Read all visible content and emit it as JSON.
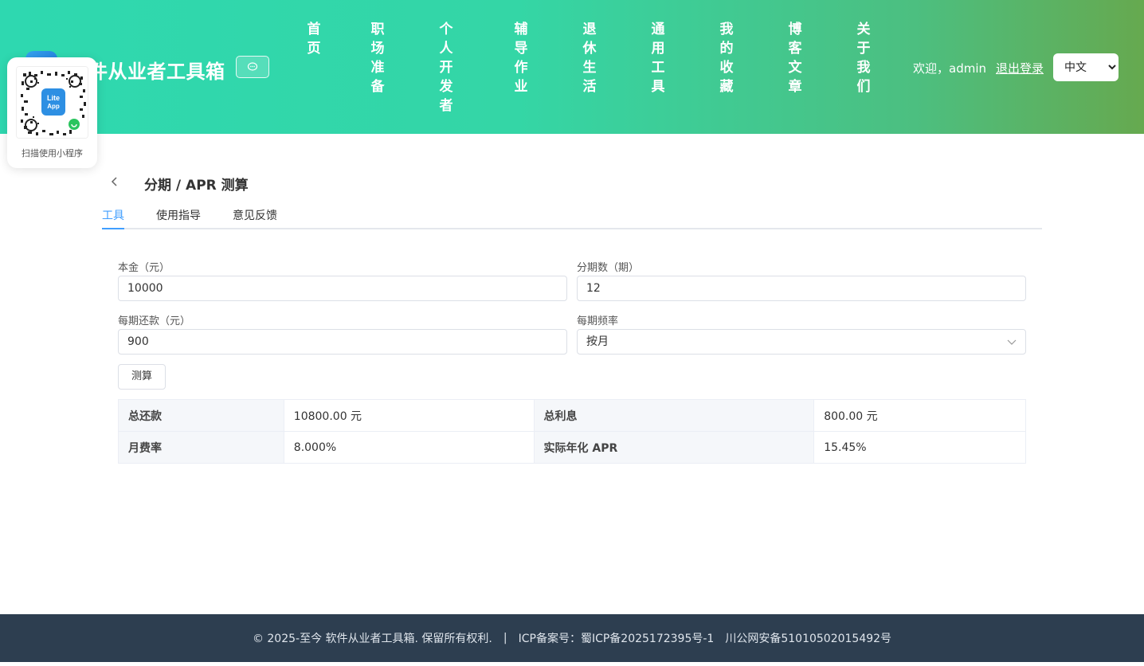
{
  "header": {
    "title": "件从业者工具箱",
    "nav": [
      "首页",
      "职场准备",
      "个人开发者",
      "辅导作业",
      "退休生活",
      "通用工具",
      "我的收藏",
      "博客文章",
      "关于我们"
    ],
    "welcome": "欢迎，admin",
    "logout": "退出登录",
    "language": "中文"
  },
  "qr_card": {
    "logo_line1": "Lite",
    "logo_line2": "App",
    "caption": "扫描使用小程序"
  },
  "page": {
    "title": "分期 / APR 测算",
    "tabs": [
      "工具",
      "使用指导",
      "意见反馈"
    ],
    "active_tab": "工具"
  },
  "form": {
    "principal_label": "本金（元）",
    "principal_value": "10000",
    "periods_label": "分期数（期）",
    "periods_value": "12",
    "payment_label": "每期还款（元）",
    "payment_value": "900",
    "frequency_label": "每期频率",
    "frequency_value": "按月",
    "calc_button": "测算"
  },
  "results": {
    "total_repay_label": "总还款",
    "total_repay_value": "10800.00 元",
    "total_interest_label": "总利息",
    "total_interest_value": "800.00 元",
    "monthly_rate_label": "月费率",
    "monthly_rate_value": "8.000%",
    "apr_label": "实际年化 APR",
    "apr_value": "15.45%"
  },
  "footer": {
    "copyright": "© 2025-至今 软件从业者工具箱. 保留所有权利.",
    "separator": "|",
    "icp": "ICP备案号：蜀ICP备2025172395号-1",
    "police": "川公网安备51010502015492号"
  },
  "colors": {
    "header_start": "#2ed8b0",
    "header_end": "#66a94f",
    "accent": "#409eff",
    "footer_bg": "#2d3e50"
  }
}
